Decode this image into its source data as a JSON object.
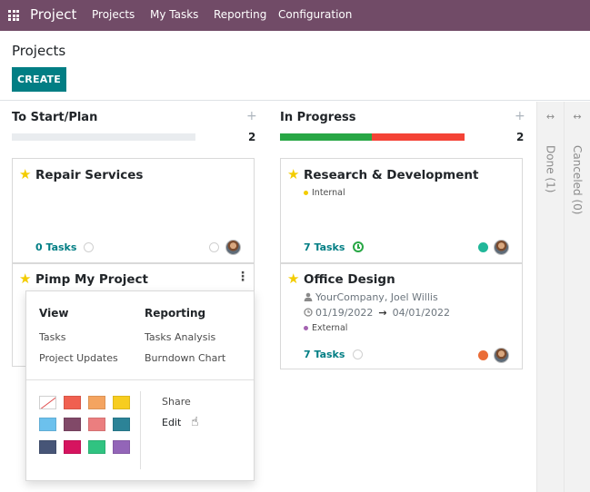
{
  "navbar": {
    "apps_icon": "apps-grid-icon",
    "brand": "Project",
    "menu": [
      "Projects",
      "My Tasks",
      "Reporting",
      "Configuration"
    ],
    "color": "#714b67"
  },
  "control": {
    "title": "Projects",
    "create_label": "CREATE",
    "create_color": "#017e84"
  },
  "columns": [
    {
      "title": "To Start/Plan",
      "count": "2",
      "plus": "+",
      "progress": {
        "green": 0,
        "red": 0
      }
    },
    {
      "title": "In Progress",
      "count": "2",
      "plus": "+",
      "progress": {
        "green": 0.5,
        "red": 0.5
      }
    }
  ],
  "folded_columns": [
    {
      "label": "Done (1)",
      "icon": "double-arrow-icon",
      "glyph": "↔"
    },
    {
      "label": "Canceled (0)",
      "icon": "double-arrow-icon",
      "glyph": "↔"
    }
  ],
  "cards": {
    "repair": {
      "title": "Repair Services",
      "tasks": "0 Tasks"
    },
    "pimp": {
      "title": "Pimp My Project",
      "menu_icon": "⋮"
    },
    "research": {
      "title": "Research & Development",
      "tag": "Internal",
      "tag_color": "#f3cc00",
      "tasks": "7 Tasks",
      "status_color": "#21b799"
    },
    "office": {
      "title": "Office Design",
      "people": "YourCompany, Joel Willis",
      "date_start": "01/19/2022",
      "date_arrow": "→",
      "date_end": "04/01/2022",
      "tag": "External",
      "tag_color": "#a463b1",
      "tasks": "7 Tasks",
      "status_color": "#ea6c37"
    }
  },
  "dropdown": {
    "view_heading": "View",
    "view_items": [
      "Tasks",
      "Project Updates"
    ],
    "reporting_heading": "Reporting",
    "reporting_items": [
      "Tasks Analysis",
      "Burndown Chart"
    ],
    "actions": [
      "Share",
      "Edit"
    ],
    "colors": [
      "none",
      "#f06050",
      "#f4a460",
      "#f7cd1f",
      "#6cc1ed",
      "#814968",
      "#eb7e7f",
      "#2c8397",
      "#475577",
      "#d6145f",
      "#30c381",
      "#9365b8"
    ]
  },
  "star_glyph": "★",
  "cursor_glyph": "☝"
}
